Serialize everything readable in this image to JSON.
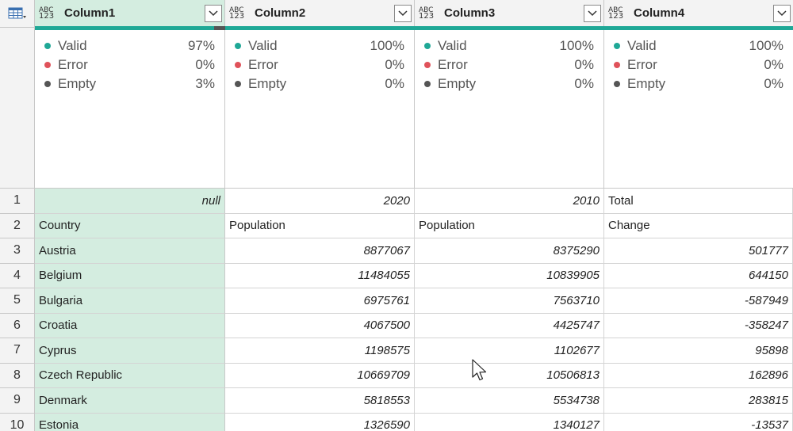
{
  "columns": [
    {
      "name": "Column1",
      "type_icon_top": "ABC",
      "type_icon_bottom": "123",
      "stats": {
        "valid": "97%",
        "error": "0%",
        "empty": "3%"
      }
    },
    {
      "name": "Column2",
      "type_icon_top": "ABC",
      "type_icon_bottom": "123",
      "stats": {
        "valid": "100%",
        "error": "0%",
        "empty": "0%"
      }
    },
    {
      "name": "Column3",
      "type_icon_top": "ABC",
      "type_icon_bottom": "123",
      "stats": {
        "valid": "100%",
        "error": "0%",
        "empty": "0%"
      }
    },
    {
      "name": "Column4",
      "type_icon_top": "ABC",
      "type_icon_bottom": "123",
      "stats": {
        "valid": "100%",
        "error": "0%",
        "empty": "0%"
      }
    }
  ],
  "stat_labels": {
    "valid": "Valid",
    "error": "Error",
    "empty": "Empty"
  },
  "rows": [
    {
      "n": "1",
      "c1": "null",
      "c2": "2020",
      "c3": "2010",
      "c4": "Total"
    },
    {
      "n": "2",
      "c1": "Country",
      "c2": "Population",
      "c3": "Population",
      "c4": "Change"
    },
    {
      "n": "3",
      "c1": "Austria",
      "c2": "8877067",
      "c3": "8375290",
      "c4": "501777"
    },
    {
      "n": "4",
      "c1": "Belgium",
      "c2": "11484055",
      "c3": "10839905",
      "c4": "644150"
    },
    {
      "n": "5",
      "c1": "Bulgaria",
      "c2": "6975761",
      "c3": "7563710",
      "c4": "-587949"
    },
    {
      "n": "6",
      "c1": "Croatia",
      "c2": "4067500",
      "c3": "4425747",
      "c4": "-358247"
    },
    {
      "n": "7",
      "c1": "Cyprus",
      "c2": "1198575",
      "c3": "1102677",
      "c4": "95898"
    },
    {
      "n": "8",
      "c1": "Czech Republic",
      "c2": "10669709",
      "c3": "10506813",
      "c4": "162896"
    },
    {
      "n": "9",
      "c1": "Denmark",
      "c2": "5818553",
      "c3": "5534738",
      "c4": "283815"
    },
    {
      "n": "10",
      "c1": "Estonia",
      "c2": "1326590",
      "c3": "1340127",
      "c4": "-13537"
    }
  ],
  "colors": {
    "valid": "#1fa896",
    "error": "#e0525a",
    "empty": "#555555",
    "selected_column": "#d4ede0"
  },
  "icons": {
    "table_menu": "table-icon",
    "dropdown": "chevron-down-icon",
    "pointer": "mouse-cursor-icon"
  }
}
